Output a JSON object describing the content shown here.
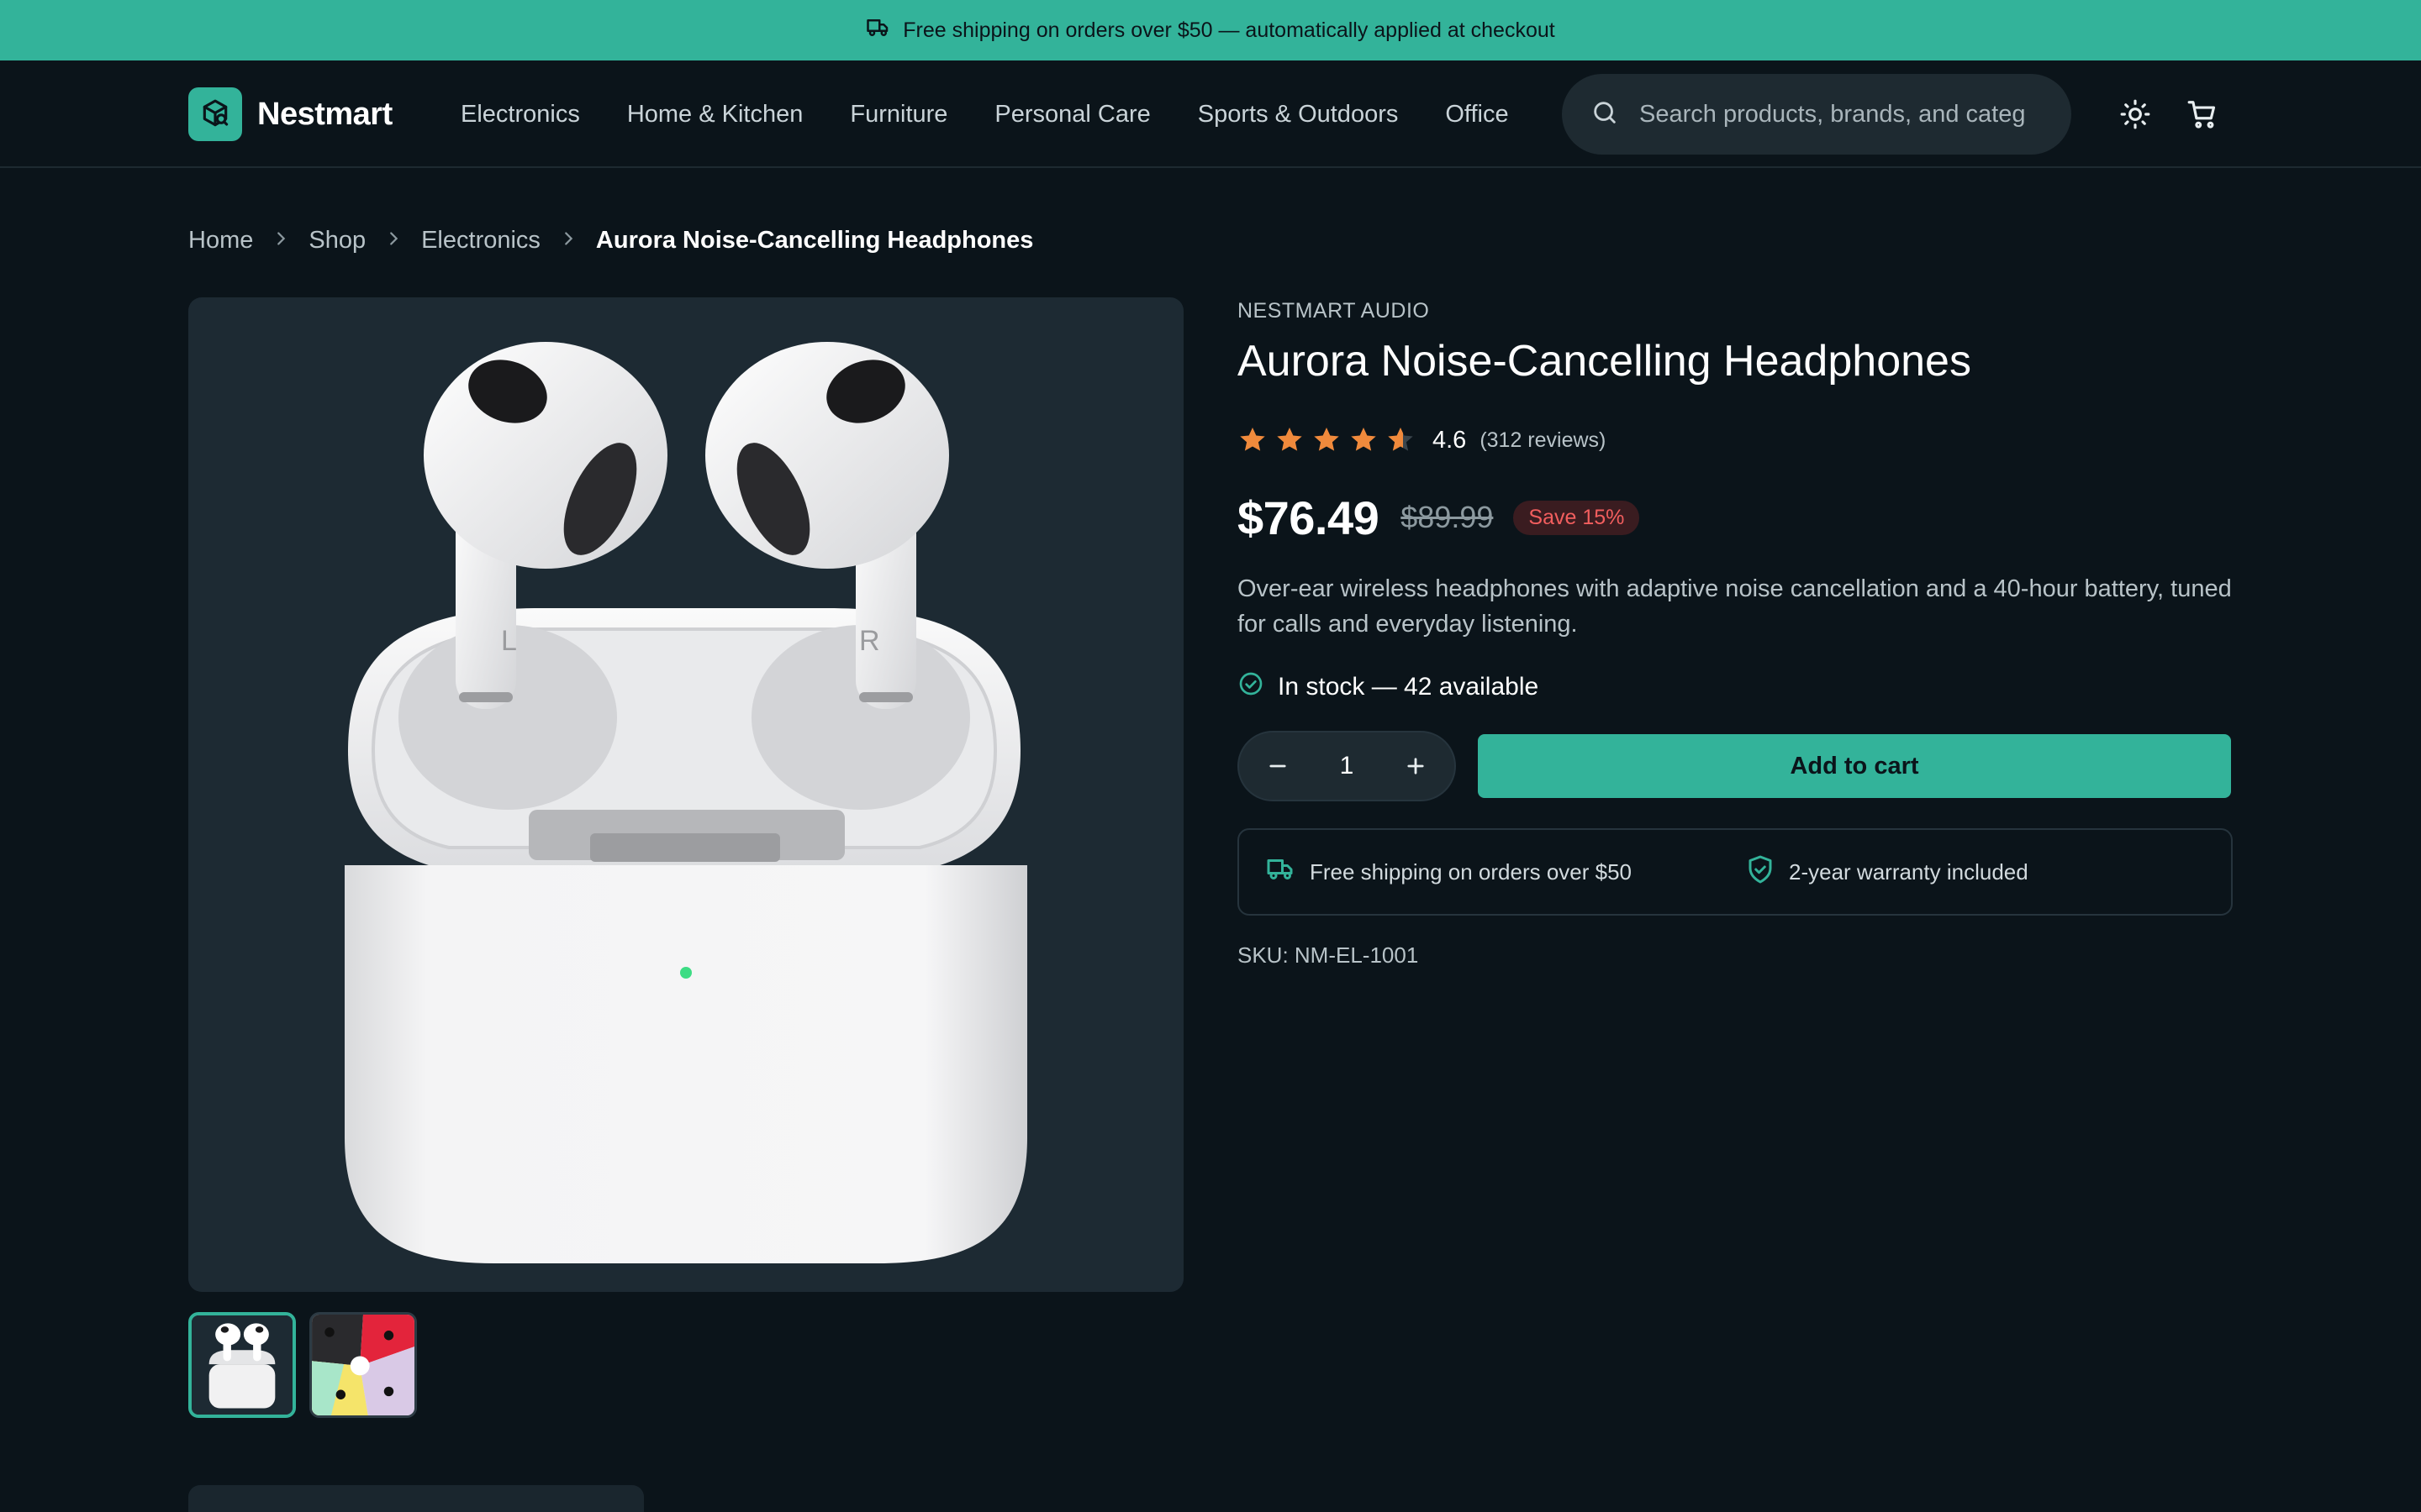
{
  "promo": {
    "icon": "truck-icon",
    "text": "Free shipping on orders over $50 — automatically applied at checkout"
  },
  "header": {
    "brand": "Nestmart",
    "logo_icon": "package-icon",
    "nav": [
      "Electronics",
      "Home & Kitchen",
      "Furniture",
      "Personal Care",
      "Sports & Outdoors",
      "Office"
    ],
    "search": {
      "placeholder": "Search products, brands, and categories",
      "value": ""
    },
    "icons": [
      "sun-icon",
      "cart-icon"
    ]
  },
  "breadcrumb": {
    "items": [
      "Home",
      "Shop",
      "Electronics"
    ],
    "current": "Aurora Noise-Cancelling Headphones"
  },
  "gallery": {
    "main_image": "white wireless earbuds in open charging case",
    "thumbnails_count": 2,
    "selected_thumbnail": 1
  },
  "product": {
    "brand": "NESTMART AUDIO",
    "title": "Aurora Noise-Cancelling Headphones",
    "rating": {
      "value": "4.6",
      "stars": 4.6,
      "max": 5,
      "count_text": "(312 reviews)"
    },
    "price": "$76.49",
    "old_price": "$89.99",
    "save_badge": "Save 15%",
    "description": "Over-ear wireless headphones with adaptive noise cancellation and a 40-hour battery, tuned for calls and everyday listening.",
    "stock": "In stock — 42 available",
    "quantity": "1",
    "add_to_cart": "Add to cart",
    "perks": [
      "Free shipping on orders over $50",
      "2-year warranty included"
    ],
    "sku": "SKU: NM-EL-1001"
  },
  "colors": {
    "accent": "#33b39a",
    "background": "#0b141a",
    "surface": "#1e2a31",
    "star": "#f08a3c",
    "sale": "#f25e5e"
  }
}
